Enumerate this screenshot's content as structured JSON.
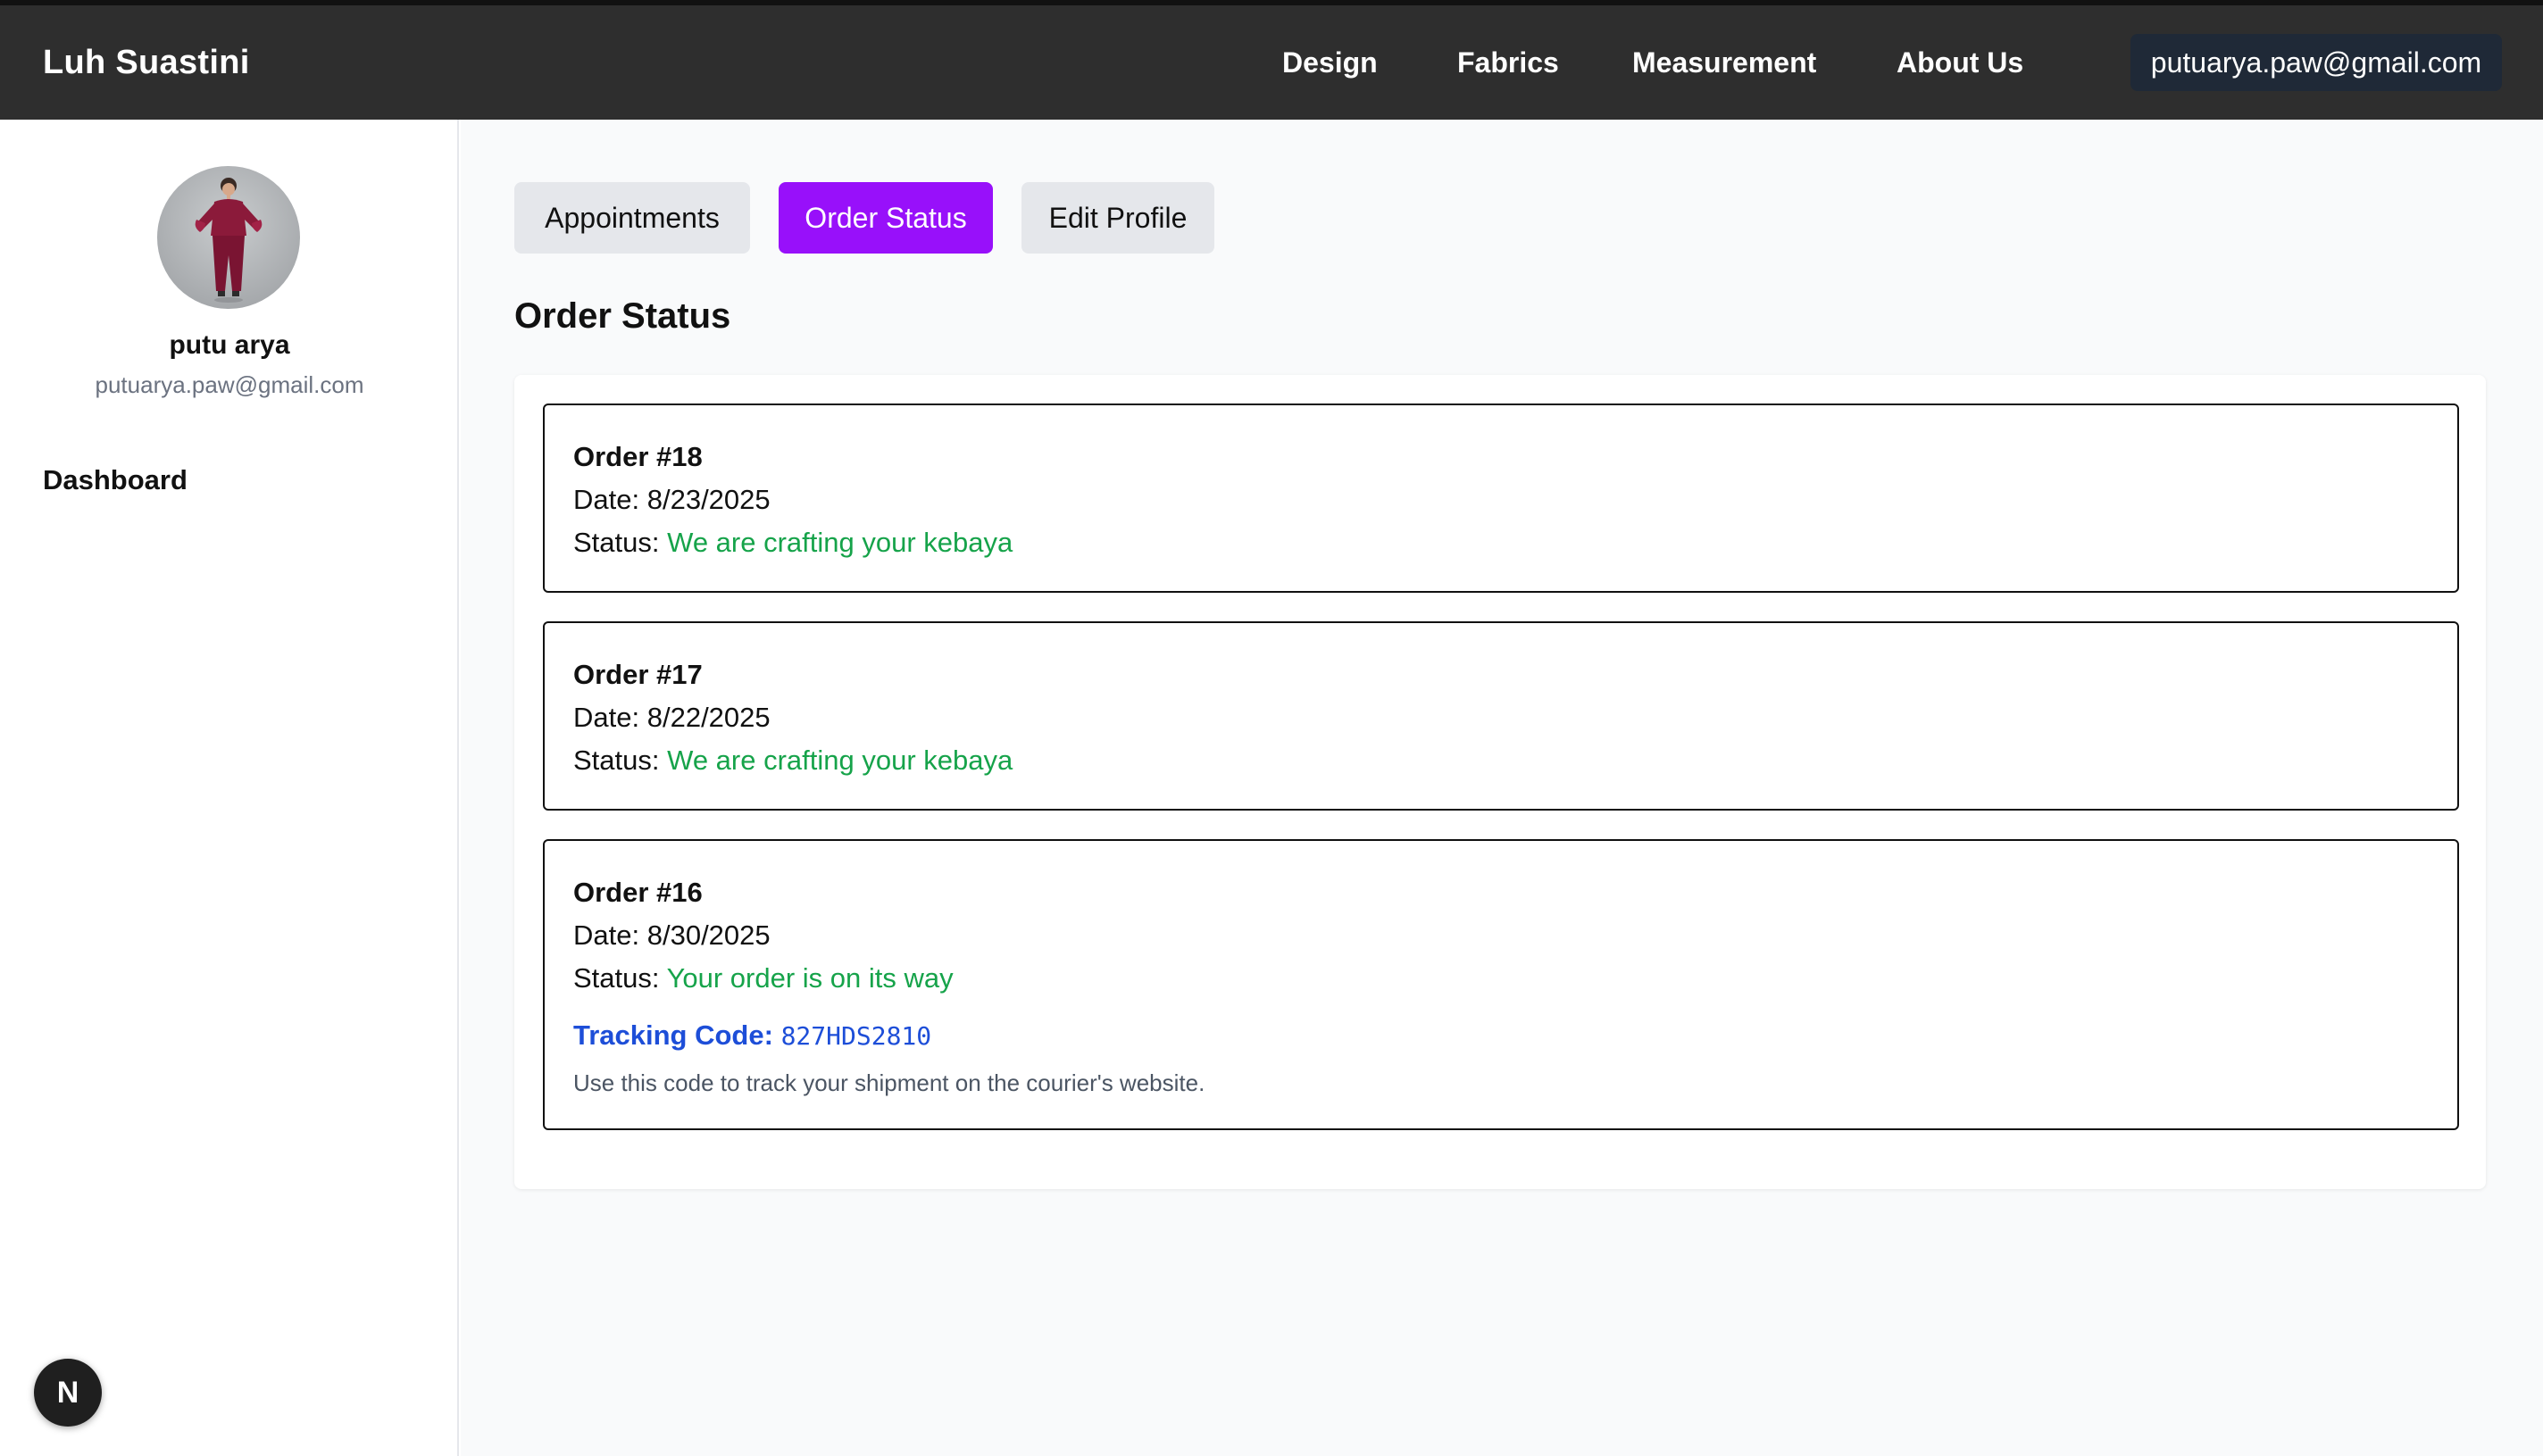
{
  "brand": "Luh Suastini",
  "nav": {
    "design": "Design",
    "fabrics": "Fabrics",
    "measurement": "Measurement",
    "about": "About Us"
  },
  "user_email": "putuarya.paw@gmail.com",
  "profile": {
    "name": "putu arya",
    "email": "putuarya.paw@gmail.com"
  },
  "sidebar": {
    "dashboard": "Dashboard"
  },
  "tabs": {
    "appointments": "Appointments",
    "order_status": "Order Status",
    "edit_profile": "Edit Profile"
  },
  "section_title": "Order Status",
  "orders": [
    {
      "title": "Order #18",
      "date_label": "Date:",
      "date": "8/23/2025",
      "status_label": "Status:",
      "status": "We are crafting your kebaya"
    },
    {
      "title": "Order #17",
      "date_label": "Date:",
      "date": "8/22/2025",
      "status_label": "Status:",
      "status": "We are crafting your kebaya"
    },
    {
      "title": "Order #16",
      "date_label": "Date:",
      "date": "8/30/2025",
      "status_label": "Status:",
      "status": "Your order is on its way",
      "tracking_label": "Tracking Code:",
      "tracking_code": "827HDS2810",
      "tracking_note": "Use this code to track your shipment on the courier's website."
    }
  ],
  "dev_badge": "N",
  "colors": {
    "topbar": "#2e2e2e",
    "accent": "#9810fa",
    "status_green": "#16a34a",
    "tracking_blue": "#1d4ed8"
  },
  "icons": {
    "avatar": "profile-photo",
    "dev_badge": "nextjs-icon"
  }
}
